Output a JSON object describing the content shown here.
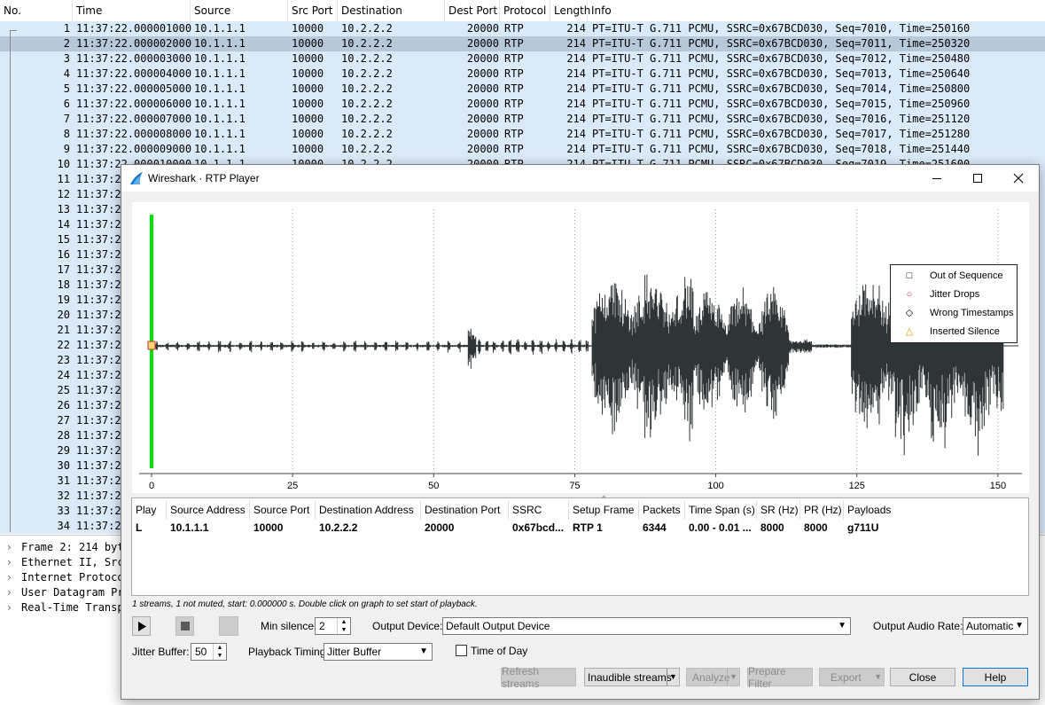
{
  "packet_list": {
    "columns": [
      "No.",
      "Time",
      "Source",
      "Src Port",
      "Destination",
      "Dest Port",
      "Protocol",
      "Length",
      "Info"
    ],
    "selected_row": 2,
    "rows": [
      {
        "no": "1",
        "time": "11:37:22.000001000",
        "src": "10.1.1.1",
        "sport": "10000",
        "dst": "10.2.2.2",
        "dport": "20000",
        "proto": "RTP",
        "len": "214",
        "info": "PT=ITU-T G.711 PCMU, SSRC=0x67BCD030, Seq=7010, Time=250160"
      },
      {
        "no": "2",
        "time": "11:37:22.000002000",
        "src": "10.1.1.1",
        "sport": "10000",
        "dst": "10.2.2.2",
        "dport": "20000",
        "proto": "RTP",
        "len": "214",
        "info": "PT=ITU-T G.711 PCMU, SSRC=0x67BCD030, Seq=7011, Time=250320"
      },
      {
        "no": "3",
        "time": "11:37:22.000003000",
        "src": "10.1.1.1",
        "sport": "10000",
        "dst": "10.2.2.2",
        "dport": "20000",
        "proto": "RTP",
        "len": "214",
        "info": "PT=ITU-T G.711 PCMU, SSRC=0x67BCD030, Seq=7012, Time=250480"
      },
      {
        "no": "4",
        "time": "11:37:22.000004000",
        "src": "10.1.1.1",
        "sport": "10000",
        "dst": "10.2.2.2",
        "dport": "20000",
        "proto": "RTP",
        "len": "214",
        "info": "PT=ITU-T G.711 PCMU, SSRC=0x67BCD030, Seq=7013, Time=250640"
      },
      {
        "no": "5",
        "time": "11:37:22.000005000",
        "src": "10.1.1.1",
        "sport": "10000",
        "dst": "10.2.2.2",
        "dport": "20000",
        "proto": "RTP",
        "len": "214",
        "info": "PT=ITU-T G.711 PCMU, SSRC=0x67BCD030, Seq=7014, Time=250800"
      },
      {
        "no": "6",
        "time": "11:37:22.000006000",
        "src": "10.1.1.1",
        "sport": "10000",
        "dst": "10.2.2.2",
        "dport": "20000",
        "proto": "RTP",
        "len": "214",
        "info": "PT=ITU-T G.711 PCMU, SSRC=0x67BCD030, Seq=7015, Time=250960"
      },
      {
        "no": "7",
        "time": "11:37:22.000007000",
        "src": "10.1.1.1",
        "sport": "10000",
        "dst": "10.2.2.2",
        "dport": "20000",
        "proto": "RTP",
        "len": "214",
        "info": "PT=ITU-T G.711 PCMU, SSRC=0x67BCD030, Seq=7016, Time=251120"
      },
      {
        "no": "8",
        "time": "11:37:22.000008000",
        "src": "10.1.1.1",
        "sport": "10000",
        "dst": "10.2.2.2",
        "dport": "20000",
        "proto": "RTP",
        "len": "214",
        "info": "PT=ITU-T G.711 PCMU, SSRC=0x67BCD030, Seq=7017, Time=251280"
      },
      {
        "no": "9",
        "time": "11:37:22.000009000",
        "src": "10.1.1.1",
        "sport": "10000",
        "dst": "10.2.2.2",
        "dport": "20000",
        "proto": "RTP",
        "len": "214",
        "info": "PT=ITU-T G.711 PCMU, SSRC=0x67BCD030, Seq=7018, Time=251440"
      },
      {
        "no": "10",
        "time": "11:37:22.000010000",
        "src": "10.1.1.1",
        "sport": "10000",
        "dst": "10.2.2.2",
        "dport": "20000",
        "proto": "RTP",
        "len": "214",
        "info": "PT=ITU-T G.711 PCMU, SSRC=0x67BCD030, Seq=7019, Time=251600"
      },
      {
        "no": "11",
        "time": "11:37:2",
        "src": "",
        "sport": "",
        "dst": "",
        "dport": "",
        "proto": "",
        "len": "",
        "info": ""
      },
      {
        "no": "12",
        "time": "11:37:2",
        "src": "",
        "sport": "",
        "dst": "",
        "dport": "",
        "proto": "",
        "len": "",
        "info": ""
      },
      {
        "no": "13",
        "time": "11:37:2",
        "src": "",
        "sport": "",
        "dst": "",
        "dport": "",
        "proto": "",
        "len": "",
        "info": ""
      },
      {
        "no": "14",
        "time": "11:37:2",
        "src": "",
        "sport": "",
        "dst": "",
        "dport": "",
        "proto": "",
        "len": "",
        "info": ""
      },
      {
        "no": "15",
        "time": "11:37:2",
        "src": "",
        "sport": "",
        "dst": "",
        "dport": "",
        "proto": "",
        "len": "",
        "info": ""
      },
      {
        "no": "16",
        "time": "11:37:2",
        "src": "",
        "sport": "",
        "dst": "",
        "dport": "",
        "proto": "",
        "len": "",
        "info": ""
      },
      {
        "no": "17",
        "time": "11:37:2",
        "src": "",
        "sport": "",
        "dst": "",
        "dport": "",
        "proto": "",
        "len": "",
        "info": ""
      },
      {
        "no": "18",
        "time": "11:37:2",
        "src": "",
        "sport": "",
        "dst": "",
        "dport": "",
        "proto": "",
        "len": "",
        "info": ""
      },
      {
        "no": "19",
        "time": "11:37:2",
        "src": "",
        "sport": "",
        "dst": "",
        "dport": "",
        "proto": "",
        "len": "",
        "info": ""
      },
      {
        "no": "20",
        "time": "11:37:2",
        "src": "",
        "sport": "",
        "dst": "",
        "dport": "",
        "proto": "",
        "len": "",
        "info": ""
      },
      {
        "no": "21",
        "time": "11:37:2",
        "src": "",
        "sport": "",
        "dst": "",
        "dport": "",
        "proto": "",
        "len": "",
        "info": ""
      },
      {
        "no": "22",
        "time": "11:37:2",
        "src": "",
        "sport": "",
        "dst": "",
        "dport": "",
        "proto": "",
        "len": "",
        "info": ""
      },
      {
        "no": "23",
        "time": "11:37:2",
        "src": "",
        "sport": "",
        "dst": "",
        "dport": "",
        "proto": "",
        "len": "",
        "info": ""
      },
      {
        "no": "24",
        "time": "11:37:2",
        "src": "",
        "sport": "",
        "dst": "",
        "dport": "",
        "proto": "",
        "len": "",
        "info": ""
      },
      {
        "no": "25",
        "time": "11:37:2",
        "src": "",
        "sport": "",
        "dst": "",
        "dport": "",
        "proto": "",
        "len": "",
        "info": ""
      },
      {
        "no": "26",
        "time": "11:37:2",
        "src": "",
        "sport": "",
        "dst": "",
        "dport": "",
        "proto": "",
        "len": "",
        "info": ""
      },
      {
        "no": "27",
        "time": "11:37:2",
        "src": "",
        "sport": "",
        "dst": "",
        "dport": "",
        "proto": "",
        "len": "",
        "info": ""
      },
      {
        "no": "28",
        "time": "11:37:2",
        "src": "",
        "sport": "",
        "dst": "",
        "dport": "",
        "proto": "",
        "len": "",
        "info": ""
      },
      {
        "no": "29",
        "time": "11:37:2",
        "src": "",
        "sport": "",
        "dst": "",
        "dport": "",
        "proto": "",
        "len": "",
        "info": ""
      },
      {
        "no": "30",
        "time": "11:37:2",
        "src": "",
        "sport": "",
        "dst": "",
        "dport": "",
        "proto": "",
        "len": "",
        "info": ""
      },
      {
        "no": "31",
        "time": "11:37:2",
        "src": "",
        "sport": "",
        "dst": "",
        "dport": "",
        "proto": "",
        "len": "",
        "info": ""
      },
      {
        "no": "32",
        "time": "11:37:2",
        "src": "",
        "sport": "",
        "dst": "",
        "dport": "",
        "proto": "",
        "len": "",
        "info": ""
      },
      {
        "no": "33",
        "time": "11:37:2",
        "src": "",
        "sport": "",
        "dst": "",
        "dport": "",
        "proto": "",
        "len": "",
        "info": ""
      },
      {
        "no": "34",
        "time": "11:37:2",
        "src": "",
        "sport": "",
        "dst": "",
        "dport": "",
        "proto": "",
        "len": "",
        "info": ""
      }
    ]
  },
  "details": {
    "items": [
      "Frame 2: 214 byt",
      "Ethernet II, Src",
      "Internet Protoco",
      "User Datagram Pr",
      "Real-Time Transp"
    ]
  },
  "dialog": {
    "title": "Wireshark · RTP Player",
    "window_buttons": {
      "minimize": "—",
      "maximize": "☐",
      "close": "✕"
    },
    "graph": {
      "x_ticks": [
        "0",
        "25",
        "50",
        "75",
        "100",
        "125",
        "150"
      ],
      "playhead_color": "#00e000",
      "waveform_color": "#2f3436"
    },
    "legend": [
      {
        "symbol": "□",
        "label": "Out of Sequence",
        "color": "#000000"
      },
      {
        "symbol": "○",
        "label": "Jitter Drops",
        "color": "#e02020"
      },
      {
        "symbol": "◇",
        "label": "Wrong Timestamps",
        "color": "#1a1a1a"
      },
      {
        "symbol": "△",
        "label": "Inserted Silence",
        "color": "#e8a000"
      }
    ],
    "streams": {
      "headers": [
        "Play",
        "Source Address",
        "Source Port",
        "Destination Address",
        "Destination Port",
        "SSRC",
        "Setup Frame",
        "Packets",
        "Time Span (s)",
        "SR (Hz)",
        "PR (Hz)",
        "Payloads"
      ],
      "rows": [
        [
          "L",
          "10.1.1.1",
          "10000",
          "10.2.2.2",
          "20000",
          "0x67bcd...",
          "RTP 1",
          "6344",
          "0.00 - 0.01 ...",
          "8000",
          "8000",
          "g711U"
        ]
      ]
    },
    "status": "1 streams, 1 not muted, start: 0.000000 s. Double click on graph to set start of playback.",
    "controls": {
      "min_silence_label": "Min silence:",
      "min_silence_value": "2",
      "output_device_label": "Output Device:",
      "output_device_value": "Default Output Device",
      "output_rate_label": "Output Audio Rate:",
      "output_rate_value": "Automatic",
      "jitter_buffer_label": "Jitter Buffer:",
      "jitter_buffer_value": "50",
      "playback_timing_label": "Playback Timing:",
      "playback_timing_value": "Jitter Buffer",
      "time_of_day_label": "Time of Day",
      "time_of_day_checked": false
    },
    "buttons": {
      "refresh": "Refresh streams",
      "inaudible": "Inaudible streams",
      "analyze": "Analyze",
      "prepare_filter": "Prepare Filter",
      "export": "Export",
      "close": "Close",
      "help": "Help"
    }
  }
}
